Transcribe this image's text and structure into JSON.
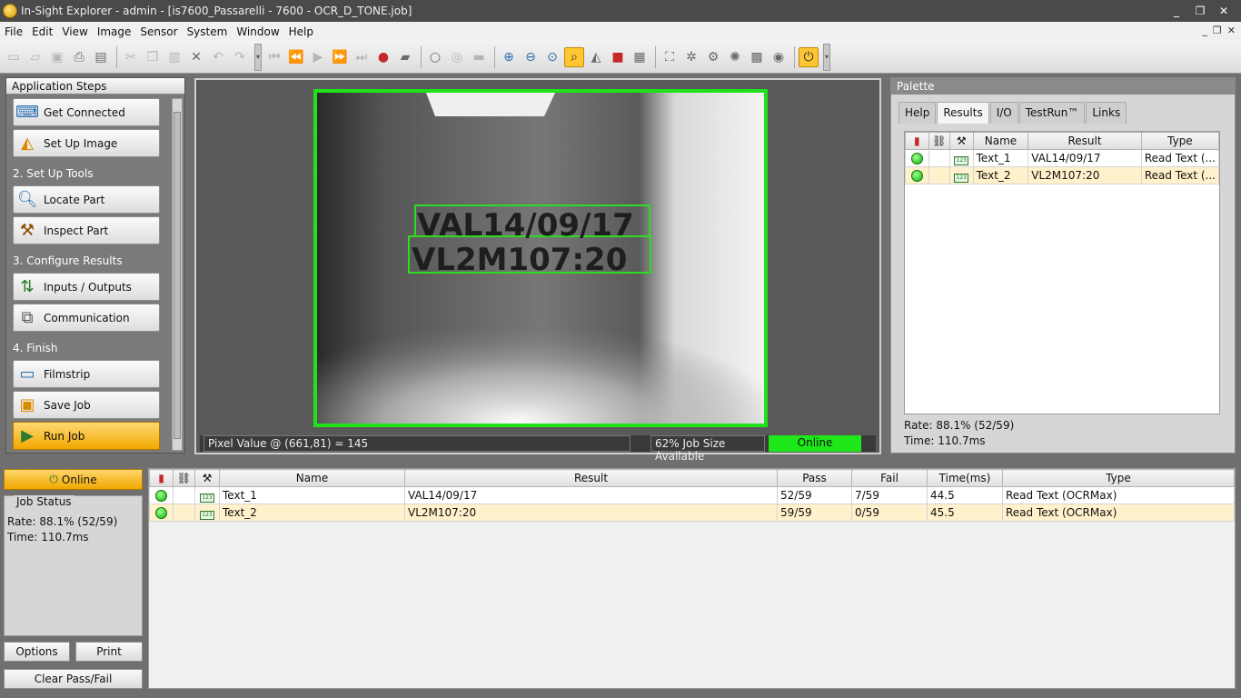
{
  "window": {
    "title": "In-Sight Explorer - admin - [is7600_Passarelli - 7600 - OCR_D_TONE.job]",
    "controls": [
      "_",
      "❐",
      "✕"
    ]
  },
  "menubar": {
    "items": [
      "File",
      "Edit",
      "View",
      "Image",
      "Sensor",
      "System",
      "Window",
      "Help"
    ],
    "mdi_controls": [
      "_",
      "❐",
      "✕"
    ]
  },
  "app_steps": {
    "header": "Application Steps",
    "sections": [
      {
        "title": "2. Set Up Tools"
      },
      {
        "title": "3. Configure Results"
      },
      {
        "title": "4. Finish"
      }
    ],
    "buttons": {
      "get_connected": "Get Connected",
      "set_up_image": "Set Up Image",
      "locate_part": "Locate Part",
      "inspect_part": "Inspect Part",
      "inputs_outputs": "Inputs / Outputs",
      "communication": "Communication",
      "filmstrip": "Filmstrip",
      "save_job": "Save Job",
      "run_job": "Run Job"
    }
  },
  "image_panel": {
    "ocr_line_1": "VAL14/09/17",
    "ocr_line_2": "VL2M107:20",
    "pixel_value": "Pixel Value @ (661,81) = 145",
    "job_size": "62% Job Size Available",
    "status": "Online"
  },
  "palette": {
    "header": "Palette",
    "tabs": [
      "Help",
      "Results",
      "I/O",
      "TestRun™",
      "Links"
    ],
    "columns": [
      "Name",
      "Result",
      "Type"
    ],
    "rows": [
      {
        "name": "Text_1",
        "result": "VAL14/09/17",
        "type": "Read Text (..."
      },
      {
        "name": "Text_2",
        "result": "VL2M107:20",
        "type": "Read Text (..."
      }
    ],
    "rate": "Rate: 88.1% (52/59)",
    "time": "Time: 110.7ms"
  },
  "online_button": "Online",
  "job_status": {
    "label": "Job Status",
    "rate": "Rate: 88.1% (52/59)",
    "time": "Time: 110.7ms"
  },
  "buttons": {
    "options": "Options",
    "print": "Print",
    "clear_pass_fail": "Clear Pass/Fail"
  },
  "results": {
    "columns": [
      "Name",
      "Result",
      "Pass",
      "Fail",
      "Time(ms)",
      "Type"
    ],
    "rows": [
      {
        "name": "Text_1",
        "result": "VAL14/09/17",
        "pass": "52/59",
        "fail": "7/59",
        "time": "44.5",
        "type": "Read Text (OCRMax)"
      },
      {
        "name": "Text_2",
        "result": "VL2M107:20",
        "pass": "59/59",
        "fail": "0/59",
        "time": "45.5",
        "type": "Read Text (OCRMax)"
      }
    ]
  },
  "colors": {
    "accent_orange": "#f2a800",
    "online_green": "#1ee81a",
    "selected_row": "#fff1cc"
  }
}
